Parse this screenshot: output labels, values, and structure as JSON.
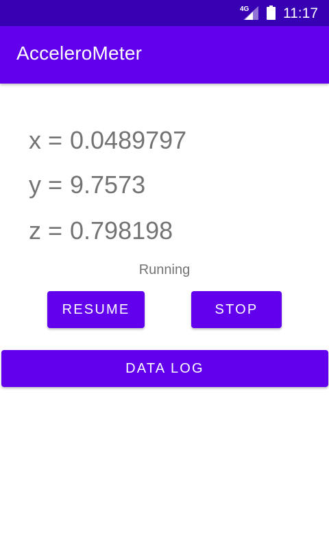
{
  "status_bar": {
    "network": "4G",
    "time": "11:17"
  },
  "app_bar": {
    "title": "AcceleroMeter"
  },
  "readings": {
    "x_label": "x =",
    "x_value": "0.0489797",
    "y_label": "y =",
    "y_value": "9.7573",
    "z_label": "z =",
    "z_value": "0.798198"
  },
  "status_text": "Running",
  "buttons": {
    "resume": "RESUME",
    "stop": "STOP",
    "data_log": "DATA LOG"
  },
  "colors": {
    "status_bar": "#3700b3",
    "primary": "#6200ee",
    "text_gray": "#737373"
  },
  "icons": [
    "signal-icon",
    "battery-icon"
  ]
}
